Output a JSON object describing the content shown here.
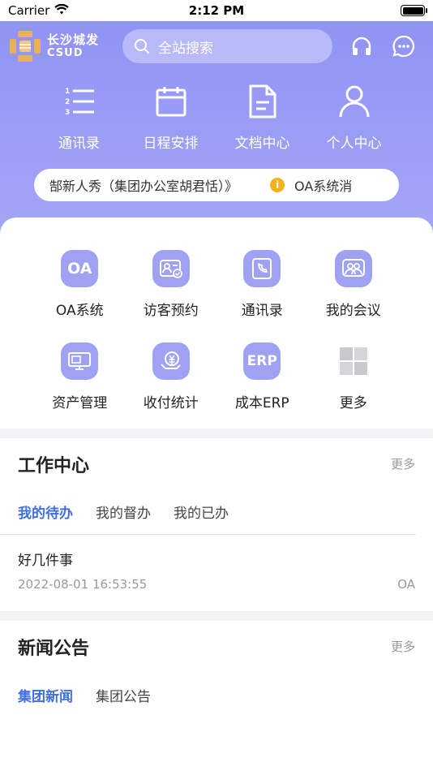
{
  "status_bar": {
    "carrier": "Carrier",
    "time": "2:12 PM"
  },
  "header": {
    "logo": {
      "cn": "长沙城发",
      "en": "CSUD"
    },
    "search_placeholder": "全站搜索",
    "icons": [
      "headset-icon",
      "chat-icon"
    ]
  },
  "quick_nav": [
    {
      "label": "通讯录",
      "icon": "contacts-list-icon"
    },
    {
      "label": "日程安排",
      "icon": "calendar-icon"
    },
    {
      "label": "文档中心",
      "icon": "document-icon"
    },
    {
      "label": "个人中心",
      "icon": "person-icon"
    }
  ],
  "notice": {
    "text": "郜新人秀（集团办公室胡君恬）》",
    "tag": "OA系统消"
  },
  "apps": [
    {
      "label": "OA系统",
      "icon": "oa-icon",
      "glyph": "OA"
    },
    {
      "label": "访客预约",
      "icon": "visitor-card-icon"
    },
    {
      "label": "通讯录",
      "icon": "phone-book-icon"
    },
    {
      "label": "我的会议",
      "icon": "meeting-icon"
    },
    {
      "label": "资产管理",
      "icon": "monitor-asset-icon"
    },
    {
      "label": "收付统计",
      "icon": "payment-icon"
    },
    {
      "label": "成本ERP",
      "icon": "erp-icon",
      "glyph": "ERP"
    },
    {
      "label": "更多",
      "icon": "grid-more-icon"
    }
  ],
  "work_center": {
    "title": "工作中心",
    "more": "更多",
    "tabs": [
      "我的待办",
      "我的督办",
      "我的已办"
    ],
    "active_tab": 0,
    "items": [
      {
        "title": "好几件事",
        "time": "2022-08-01 16:53:55",
        "source": "OA"
      }
    ]
  },
  "news": {
    "title": "新闻公告",
    "more": "更多",
    "tabs": [
      "集团新闻",
      "集团公告"
    ],
    "active_tab": 0
  },
  "colors": {
    "primary": "#9496f4",
    "accent": "#3f6fe0",
    "warning": "#f5b21b"
  }
}
